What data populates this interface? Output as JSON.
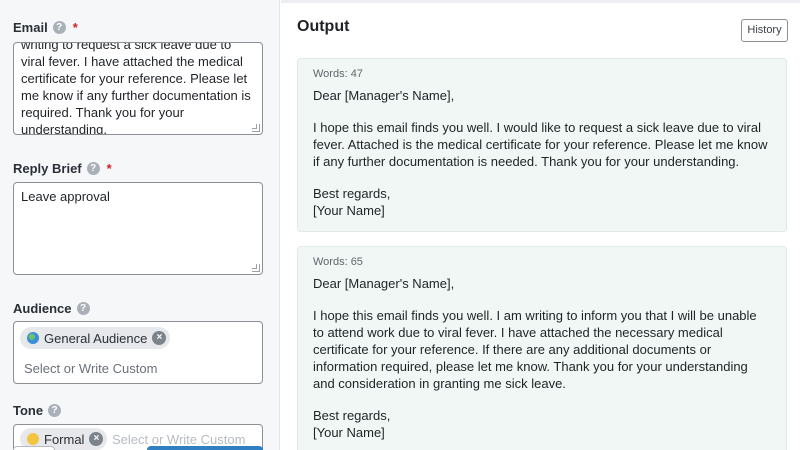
{
  "form": {
    "email": {
      "label": "Email",
      "value": "writing to request a sick leave due to viral fever. I have attached the medical certificate for your reference. Please let me know if any further documentation is required. Thank you for your understanding."
    },
    "reply_brief": {
      "label": "Reply Brief",
      "value": "Leave approval"
    },
    "audience": {
      "label": "Audience",
      "chip": "General Audience",
      "placeholder": "Select or Write Custom"
    },
    "tone": {
      "label": "Tone",
      "chip": "Formal",
      "placeholder": "Select or Write Custom"
    },
    "help_glyph": "?",
    "required_glyph": "*",
    "remove_glyph": "×"
  },
  "output": {
    "title": "Output",
    "history_label": "History",
    "results": [
      {
        "words": "Words: 47",
        "paragraphs": [
          "Dear [Manager's Name],",
          "I hope this email finds you well. I would like to request a sick leave due to viral fever. Attached is the medical certificate for your reference. Please let me know if any further documentation is needed. Thank you for your understanding.",
          "Best regards,\n[Your Name]"
        ]
      },
      {
        "words": "Words: 65",
        "paragraphs": [
          "Dear [Manager's Name],",
          "I hope this email finds you well. I am writing to inform you that I will be unable to attend work due to viral fever. I have attached the necessary medical certificate for your reference. If there are any additional documents or information required, please let me know. Thank you for your understanding and consideration in granting me sick leave.",
          "Best regards,\n[Your Name]"
        ]
      }
    ]
  },
  "colors": {
    "accent": "#2f7fc2",
    "required": "#d0202a",
    "card_bg": "#f0f7f4"
  }
}
